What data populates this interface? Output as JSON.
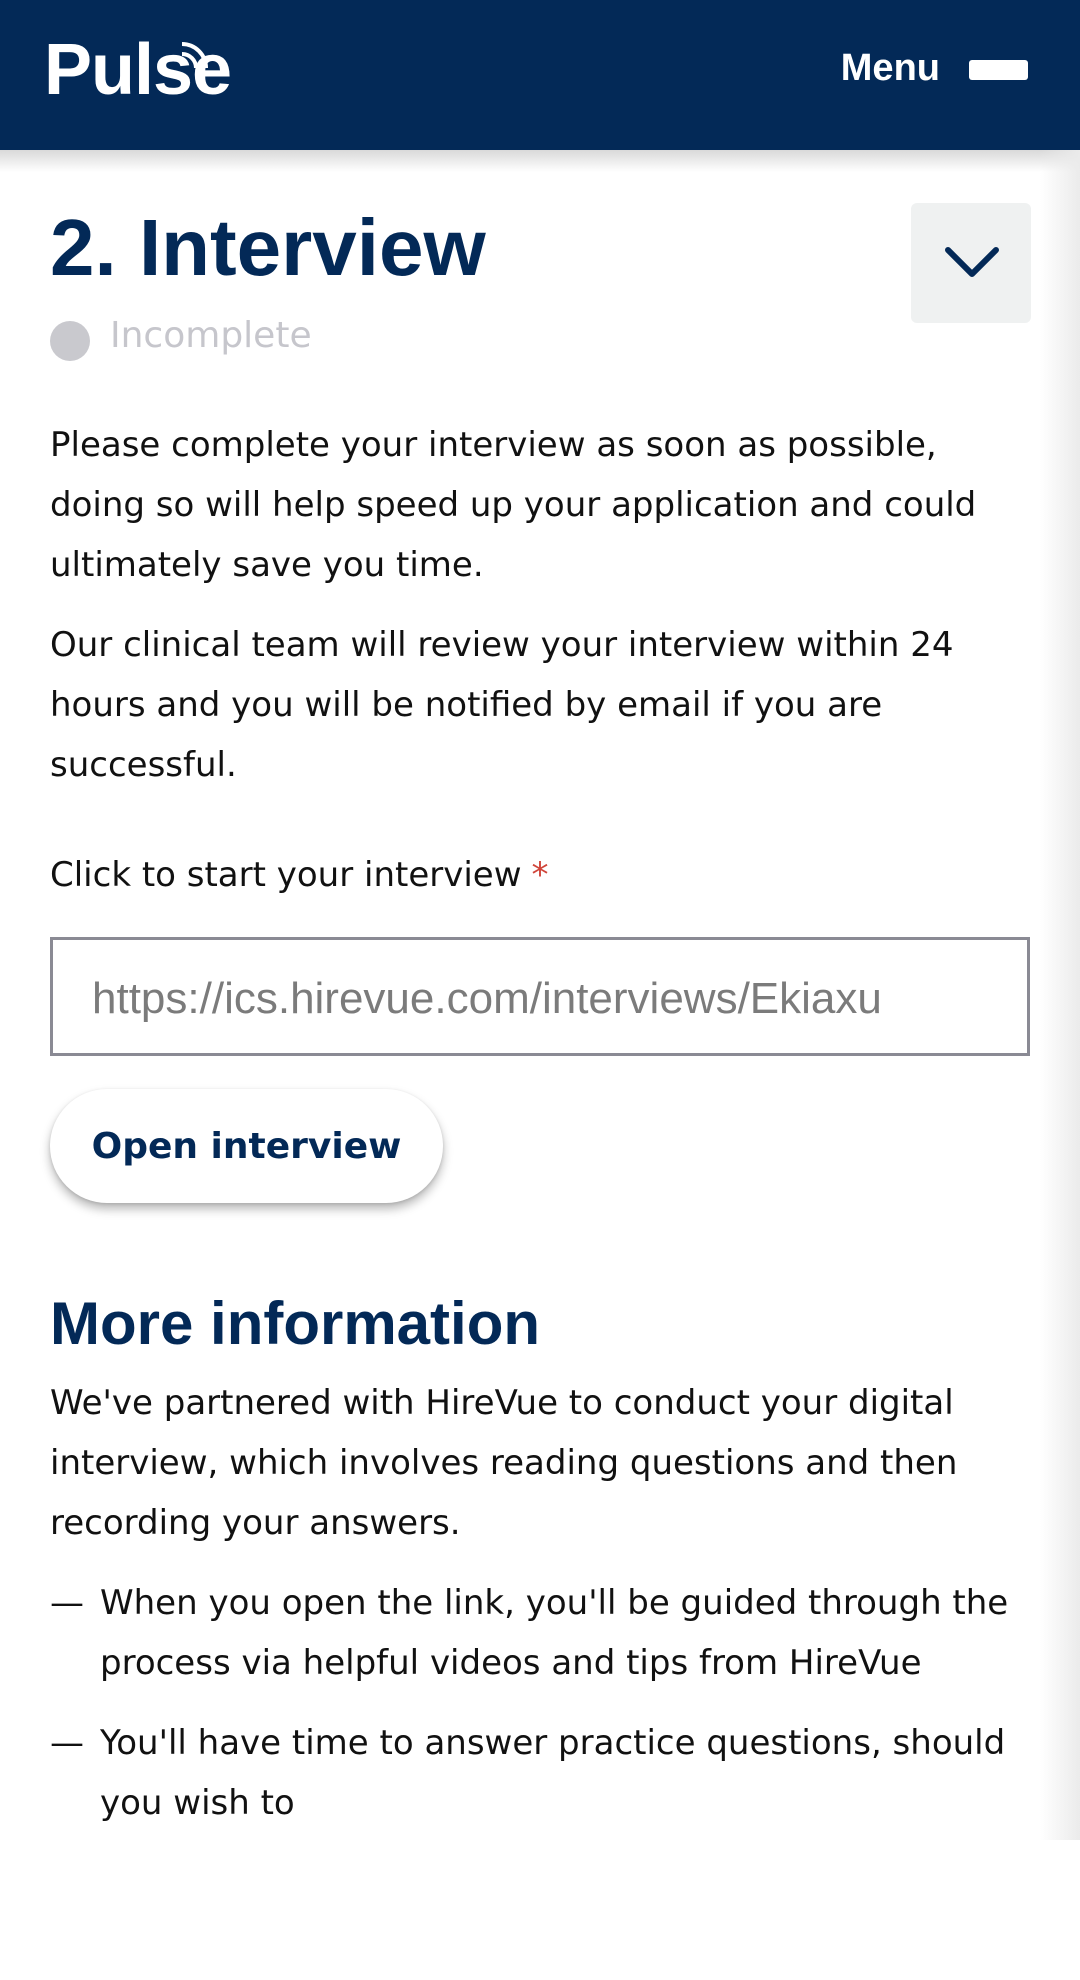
{
  "header": {
    "logo_text": "Pulse",
    "menu_label": "Menu",
    "background_color": "#032957"
  },
  "section": {
    "title": "2. Interview",
    "status": "Incomplete",
    "collapse_icon": "chevron-down-icon",
    "paragraphs": [
      "Please complete your interview as soon as possible, doing so will help speed up your application and could ultimately save you time.",
      "Our clinical team will review your interview within 24 hours and you will be notified by email if you are successful."
    ],
    "field_label": "Click to start your interview",
    "required_mark": "*",
    "url_value": "https://ics.hirevue.com/interviews/Ekiaxu",
    "open_button_label": "Open interview"
  },
  "more_info": {
    "title": "More information",
    "intro": "We've partnered with HireVue to conduct your digital interview, which involves reading questions and then recording your answers.",
    "bullet_marker": "—",
    "bullets": [
      "When you open the link, you'll be guided through the process via helpful videos and tips from HireVue",
      "You'll have time to answer practice questions, should you wish to"
    ]
  },
  "colors": {
    "brand_navy": "#032957",
    "required_red": "#d0453a",
    "status_grey": "#c9c9ce"
  }
}
